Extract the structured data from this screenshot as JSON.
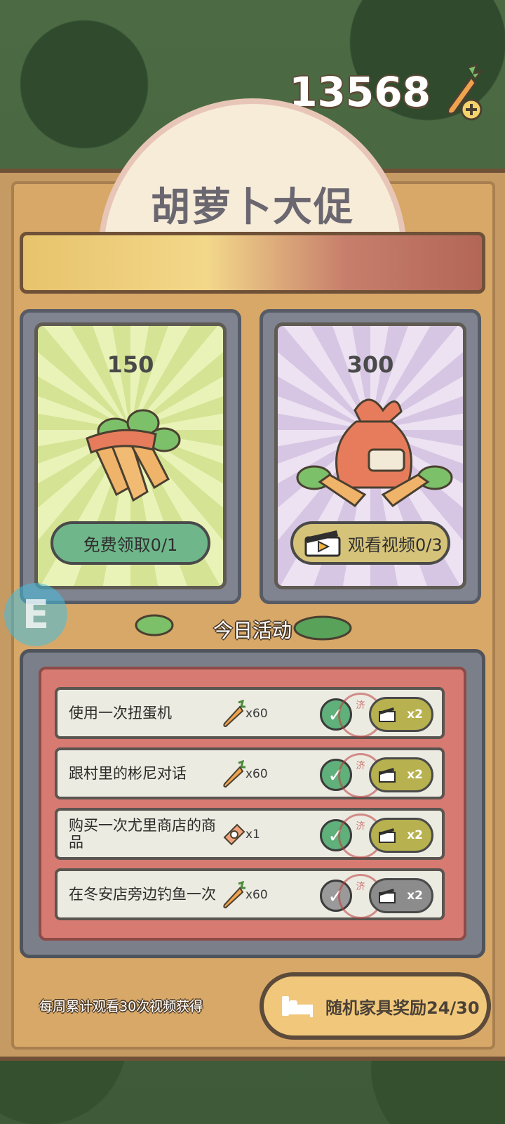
{
  "header": {
    "currency_value": "13568",
    "currency_icon": "carrot-plus-icon"
  },
  "banner": {
    "title": "胡萝卜大促"
  },
  "offers": [
    {
      "amount": "150",
      "art_icon": "carrot-bundle-icon",
      "button_label": "免费领取0/1",
      "color": "#6fb78b"
    },
    {
      "amount": "300",
      "art_icon": "carrot-bag-icon",
      "button_icon": "clapperboard-icon",
      "button_label": "观看视频0/3",
      "color": "#d6c37a"
    }
  ],
  "side_badge": {
    "letter": "E"
  },
  "daily": {
    "title": "今日活动",
    "tasks": [
      {
        "name": "使用一次扭蛋机",
        "reward_icon": "carrot-icon",
        "reward_qty": "x60",
        "stamp": "济",
        "status": "complete",
        "multiplier": "x2"
      },
      {
        "name": "跟村里的彬尼对话",
        "reward_icon": "carrot-icon",
        "reward_qty": "x60",
        "stamp": "济",
        "status": "complete",
        "multiplier": "x2"
      },
      {
        "name": "购买一次尤里商店的商品",
        "reward_icon": "ticket-icon",
        "reward_qty": "x1",
        "stamp": "济",
        "status": "complete",
        "multiplier": "x2"
      },
      {
        "name": "在冬安店旁边钓鱼一次",
        "reward_icon": "carrot-icon",
        "reward_qty": "x60",
        "stamp": "济",
        "status": "incomplete",
        "multiplier": "x2"
      }
    ]
  },
  "footer": {
    "note": "每周累计观看30次视频获得",
    "reward_label": "随机家具奖励24/30",
    "reward_icon": "bed-icon"
  },
  "colors": {
    "complete": "#5fb07a",
    "incomplete": "#9a9a9a",
    "double_active": "#b7b14f",
    "double_inactive": "#8c8c8c"
  }
}
